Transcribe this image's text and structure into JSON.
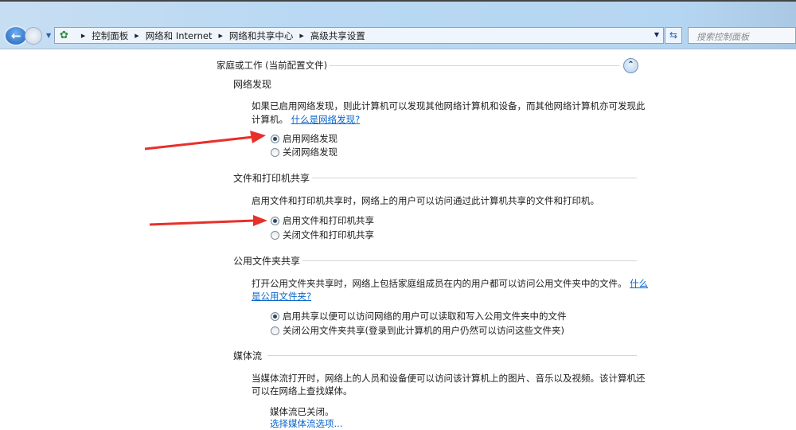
{
  "address_bar": {
    "breadcrumbs": [
      "控制面板",
      "网络和 Internet",
      "网络和共享中心",
      "高级共享设置"
    ]
  },
  "search": {
    "placeholder": "搜索控制面板"
  },
  "profile": {
    "title": "家庭或工作 (当前配置文件)"
  },
  "network_discovery": {
    "heading": "网络发现",
    "description": "如果已启用网络发现，则此计算机可以发现其他网络计算机和设备，而其他网络计算机亦可发现此",
    "description2": "计算机。",
    "help_link": "什么是网络发现?",
    "options": [
      {
        "label": "启用网络发现",
        "selected": true
      },
      {
        "label": "关闭网络发现",
        "selected": false
      }
    ]
  },
  "file_printer_sharing": {
    "heading": "文件和打印机共享",
    "description": "启用文件和打印机共享时，网络上的用户可以访问通过此计算机共享的文件和打印机。",
    "options": [
      {
        "label": "启用文件和打印机共享",
        "selected": true
      },
      {
        "label": "关闭文件和打印机共享",
        "selected": false
      }
    ]
  },
  "public_folder_sharing": {
    "heading": "公用文件夹共享",
    "description": "打开公用文件夹共享时，网络上包括家庭组成员在内的用户都可以访问公用文件夹中的文件。",
    "help_link_a": "什么",
    "help_link_b": "是公用文件夹?",
    "options": [
      {
        "label": "启用共享以便可以访问网络的用户可以读取和写入公用文件夹中的文件",
        "selected": true
      },
      {
        "label": "关闭公用文件夹共享(登录到此计算机的用户仍然可以访问这些文件夹)",
        "selected": false
      }
    ]
  },
  "media_streaming": {
    "heading": "媒体流",
    "description": "当媒体流打开时，网络上的人员和设备便可以访问该计算机上的图片、音乐以及视频。该计算机还",
    "description2": "可以在网络上查找媒体。",
    "status": "媒体流已关闭。",
    "options_link": "选择媒体流选项..."
  },
  "colors": {
    "arrow": "#e8302a",
    "link": "#0a66cc"
  }
}
